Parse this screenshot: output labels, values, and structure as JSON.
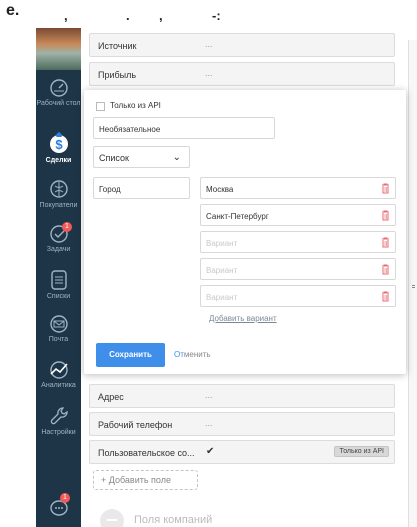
{
  "caption": {
    "letter": "e.",
    "punct": [
      ",",
      ".",
      ",",
      "-:"
    ]
  },
  "sidebar": {
    "items": [
      {
        "label": "Рабочий стол",
        "icon": "dashboard-icon"
      },
      {
        "label": "Сделки",
        "icon": "deals-icon",
        "active": true
      },
      {
        "label": "Покупатели",
        "icon": "customers-icon"
      },
      {
        "label": "Задачи",
        "icon": "tasks-icon",
        "badge": "1"
      },
      {
        "label": "Списки",
        "icon": "lists-icon"
      },
      {
        "label": "Почта",
        "icon": "mail-icon"
      },
      {
        "label": "Аналитика",
        "icon": "analytics-icon"
      },
      {
        "label": "Настройки",
        "icon": "settings-icon"
      }
    ],
    "chat_badge": "1"
  },
  "rows_top": [
    {
      "label": "Источник",
      "value": "..."
    },
    {
      "label": "Прибыль",
      "value": "..."
    }
  ],
  "rows_bottom": [
    {
      "label": "Адрес",
      "value": "..."
    },
    {
      "label": "Рабочий телефон",
      "value": "..."
    },
    {
      "label": "Пользовательское со...",
      "value": "✔",
      "tag": "Только из API"
    }
  ],
  "add_field_label": "+ Добавить поле",
  "section_title": "Поля компаний",
  "modal": {
    "api_only_label": "Только из API",
    "api_only_checked": false,
    "optional_placeholder": "Необязательное",
    "type_select_value": "Список",
    "field_name_value": "Город",
    "variants": [
      {
        "value": "Москва",
        "placeholder": ""
      },
      {
        "value": "Санкт-Петербург",
        "placeholder": ""
      },
      {
        "value": "",
        "placeholder": "Вариант"
      },
      {
        "value": "",
        "placeholder": "Вариант"
      },
      {
        "value": "",
        "placeholder": "Вариант"
      }
    ],
    "add_variant_label": "Добавить вариант",
    "save_label": "Сохранить",
    "cancel_label_highlight": "От",
    "cancel_label_rest": "менить"
  },
  "colors": {
    "sidebar_bg": "#1e3547",
    "accent_blue": "#3e8eea",
    "trash_red": "#e9696f",
    "badge_red": "#f25a5a"
  }
}
